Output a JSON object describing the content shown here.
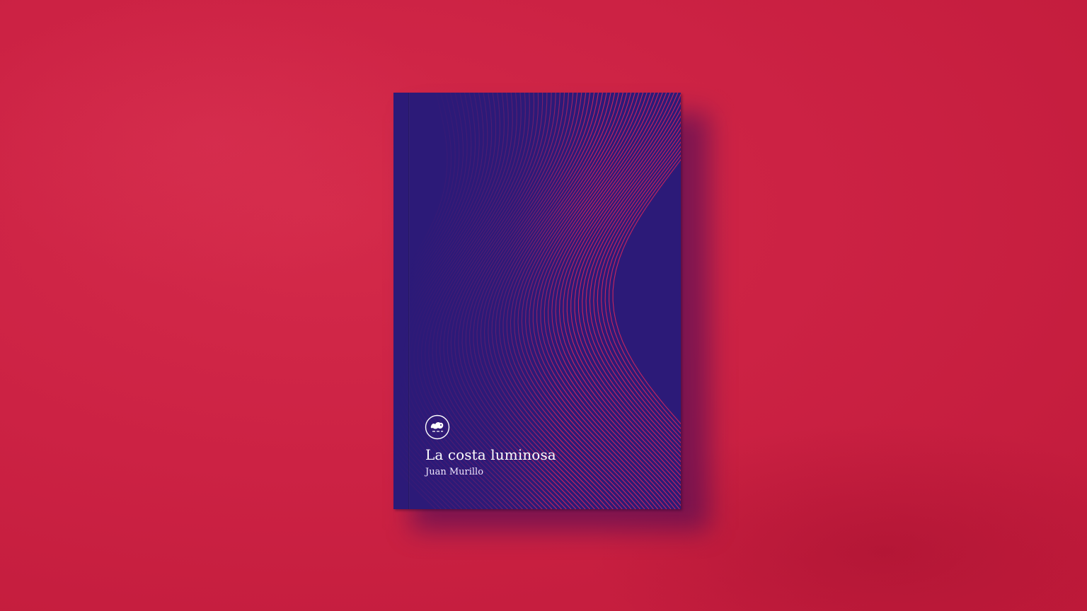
{
  "scene": {
    "background_color": "#cc2244",
    "book_color": "#2c1a78",
    "line_color": "#e0285a"
  },
  "book": {
    "title": "La costa luminosa",
    "author": "Juan Murillo",
    "logo_icon": "publisher-seal-icon"
  }
}
